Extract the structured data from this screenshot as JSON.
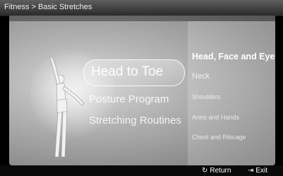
{
  "header": {
    "breadcrumb": "Fitness > Basic Stretches"
  },
  "main_menu": {
    "items": [
      {
        "label": "Head to Toe",
        "selected": true
      },
      {
        "label": "Posture Program",
        "selected": false
      },
      {
        "label": "Stretching Routines",
        "selected": false
      }
    ]
  },
  "submenu": {
    "items": [
      {
        "label": "Head, Face and Eyes",
        "selected": true
      },
      {
        "label": "Neck",
        "selected": false
      },
      {
        "label": "Shoulders",
        "selected": false
      },
      {
        "label": "Arms and Hands",
        "selected": false
      },
      {
        "label": "Chest and Ribcage",
        "selected": false
      }
    ]
  },
  "footer": {
    "return": {
      "icon": "return-icon",
      "label": "Return"
    },
    "exit": {
      "icon": "exit-icon",
      "label": "Exit"
    }
  },
  "colors": {
    "background": "#000000",
    "panel": "#b4b4b4",
    "text": "#ffffff"
  }
}
